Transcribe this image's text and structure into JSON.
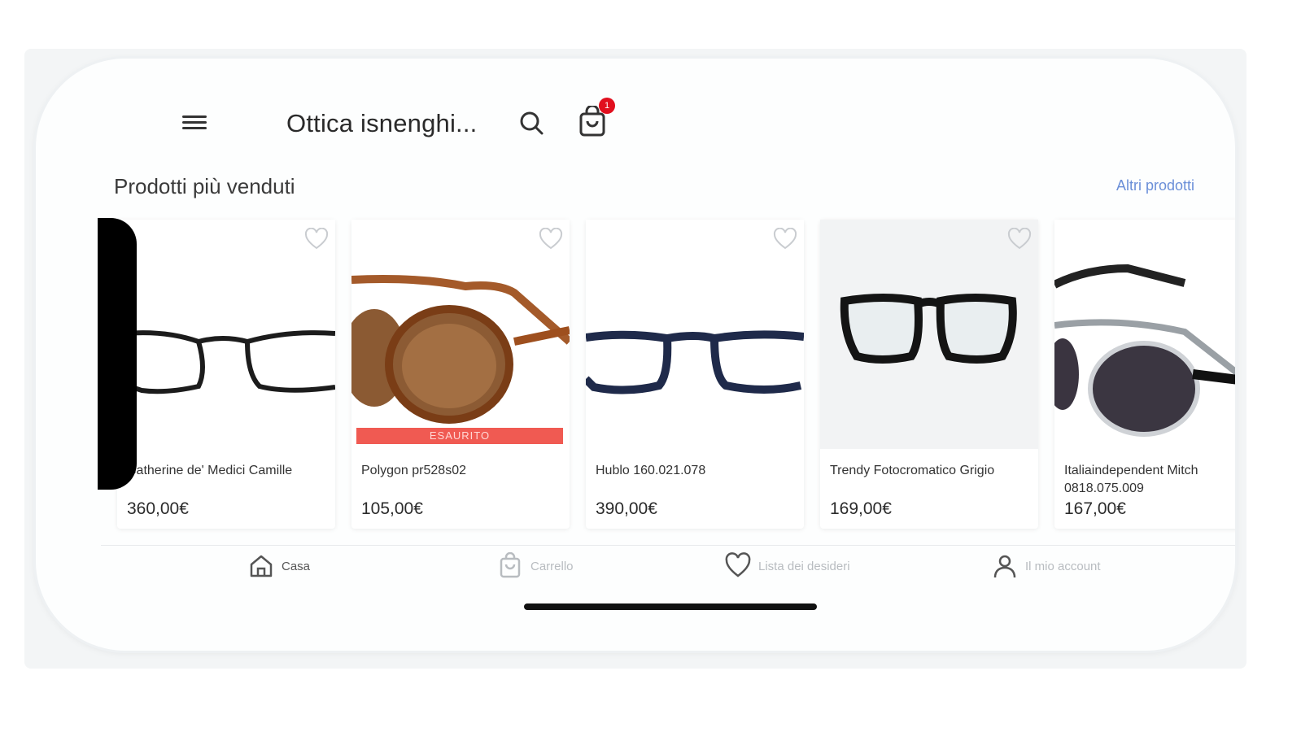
{
  "header": {
    "title": "Ottica isnenghi...",
    "cart_count": "1",
    "menu_icon": "hamburger-icon",
    "search_icon": "search-icon",
    "cart_icon": "shopping-bag-icon"
  },
  "section": {
    "title": "Prodotti più venduti",
    "more_link": "Altri prodotti"
  },
  "products": [
    {
      "name": "Catherine de' Medici Camille",
      "price": "360,00€",
      "sold_out": false
    },
    {
      "name": "Polygon pr528s02",
      "price": "105,00€",
      "sold_out": true,
      "badge": "ESAURITO"
    },
    {
      "name": "Hublo 160.021.078",
      "price": "390,00€",
      "sold_out": false
    },
    {
      "name": "Trendy Fotocromatico Grigio",
      "price": "169,00€",
      "sold_out": false
    },
    {
      "name": "Italiaindependent Mitch 0818.075.009",
      "price": "167,00€",
      "sold_out": false
    }
  ],
  "nav": {
    "items": [
      {
        "label": "Casa",
        "icon": "home-icon",
        "active": true
      },
      {
        "label": "Carrello",
        "icon": "cart-icon",
        "active": false
      },
      {
        "label": "Lista dei desideri",
        "icon": "heart-icon",
        "active": false
      },
      {
        "label": "Il mio account",
        "icon": "user-icon",
        "active": false
      }
    ]
  },
  "colors": {
    "badge": "#e10f1e",
    "sold_out": "#f05a52",
    "link": "#6b8fd8"
  }
}
